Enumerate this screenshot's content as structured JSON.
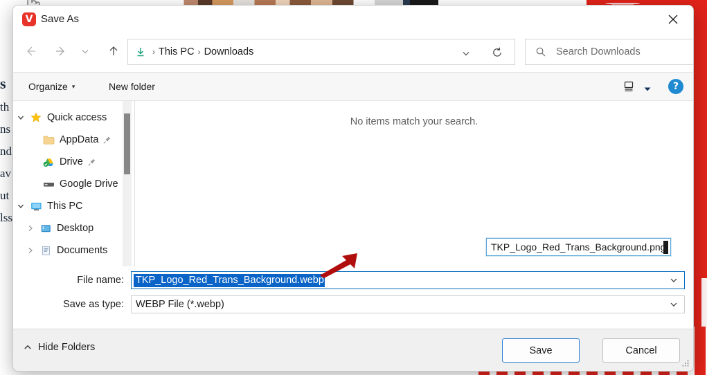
{
  "background": {
    "left_text_lines": [
      "s",
      "th",
      "ns",
      "nd",
      "av",
      "ut",
      "",
      "",
      "lss"
    ],
    "accent_red": "#e2231a"
  },
  "dialog": {
    "title": "Save As",
    "app_icon": "vivaldi-logo-icon",
    "close_label": "✕",
    "nav": {
      "back_icon": "arrow-left-icon",
      "forward_icon": "arrow-right-icon",
      "recent_icon": "chevron-down-icon",
      "up_icon": "arrow-up-icon",
      "breadcrumb_icon": "downloads-icon",
      "breadcrumb": [
        "This PC",
        "Downloads"
      ],
      "breadcrumb_separator": "›",
      "dropdown_icon": "chevron-down-icon",
      "refresh_icon": "refresh-icon"
    },
    "search": {
      "icon": "search-icon",
      "placeholder": "Search Downloads",
      "value": ""
    },
    "command_bar": {
      "organize_label": "Organize",
      "organize_caret": "▾",
      "new_folder_label": "New folder",
      "view_icon": "view-layout-icon",
      "view_caret_icon": "chevron-down-icon",
      "help_label": "?",
      "help_icon": "help-icon"
    },
    "nav_pane": {
      "items": [
        {
          "label": "Quick access",
          "icon": "star-icon",
          "twisty": "expanded",
          "indent": 0,
          "pinned": false
        },
        {
          "label": "AppData",
          "icon": "folder-icon",
          "twisty": "none",
          "indent": 1,
          "pinned": true
        },
        {
          "label": "Drive",
          "icon": "google-drive-sync-icon",
          "twisty": "none",
          "indent": 1,
          "pinned": true
        },
        {
          "label": "Google Drive",
          "icon": "drive-disk-icon",
          "twisty": "none",
          "indent": 1,
          "pinned": true
        },
        {
          "label": "This PC",
          "icon": "monitor-icon",
          "twisty": "expanded",
          "indent": 0,
          "pinned": false
        },
        {
          "label": "Desktop",
          "icon": "desktop-folder-icon",
          "twisty": "collapsed",
          "indent": 1,
          "pinned": false
        },
        {
          "label": "Documents",
          "icon": "documents-icon",
          "twisty": "collapsed",
          "indent": 1,
          "pinned": false
        }
      ]
    },
    "file_pane": {
      "empty_message": "No items match your search."
    },
    "floating_edit": {
      "value": "TKP_Logo_Red_Trans_Background.png"
    },
    "annotation": {
      "arrow_color": "#b00d0d",
      "name": "red-arrow-annotation"
    },
    "form": {
      "file_name_label": "File name:",
      "file_name_value": "TKP_Logo_Red_Trans_Background.webp",
      "save_as_type_label": "Save as type:",
      "save_as_type_value": "WEBP File (*.webp)"
    },
    "footer": {
      "hide_folders_label": "Hide Folders",
      "hide_folders_icon": "chevron-up-icon",
      "save_label": "Save",
      "cancel_label": "Cancel"
    }
  }
}
